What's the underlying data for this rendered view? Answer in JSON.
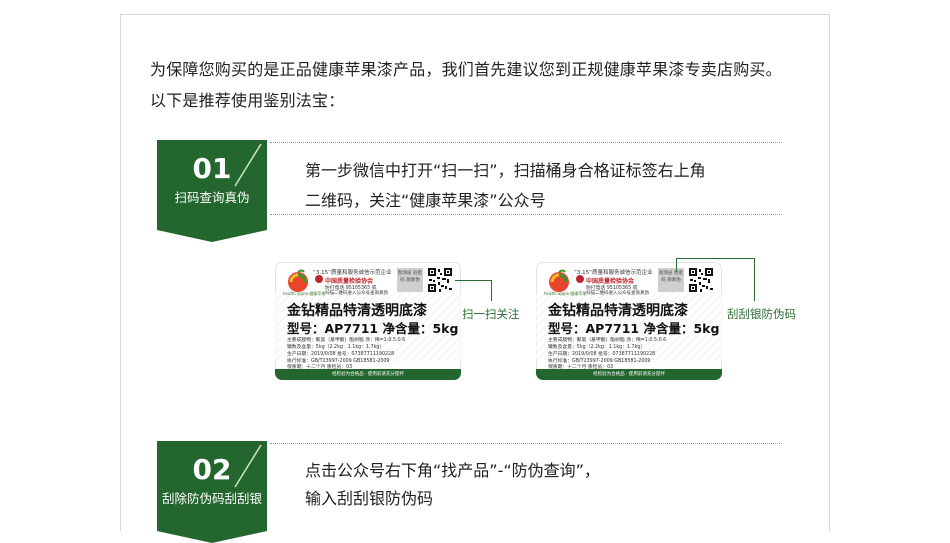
{
  "intro": {
    "line1": "为保障您购买的是正品健康苹果漆产品，我们首先建议您到正规健康苹果漆专卖店购买。",
    "line2": "以下是推荐使用鉴别法宝："
  },
  "steps": [
    {
      "number": "01",
      "title": "扫码查询真伪",
      "text1": "第一步微信中打开“扫一扫”，扫描桶身合格证标签右上角",
      "text2": "二维码，关注“健康苹果漆”公众号"
    },
    {
      "number": "02",
      "title": "刮除防伪码刮刮银",
      "text1": "点击公众号右下角“找产品”-“防伪查询”，",
      "text2": "输入刮刮银防伪码"
    }
  ],
  "label": {
    "logo_text": "health apple 健康苹果",
    "header1": "“3.15”质量和服务诚信示范企业",
    "header2": "中国质量检验协会",
    "header3": "防打电话 95105365 或",
    "header4": "扫描二维码进入公众号查询真伪",
    "scratch_text": "刮涂层 验密码 辨真伪",
    "product_name": "金钻精品特清透明底漆",
    "model_line": "型号：AP7711 净含量：5kg",
    "spec1": "主要成膜物：聚氨（基甲酸）酯树脂    涂：稀=1:0.5:0.6",
    "spec2": "罐数及含量：5kg（2.2kg：1.1kg：1.7kg）",
    "spec3": "生产日期：2019/0/08   批号：07387711190228",
    "spec4": "执行标准：GB/T23997-2009   GB18581-2009",
    "spec5": "保质期：十二个月   质检员：03",
    "footer": "经检验为合格品 · 使用前请充分搅拌"
  },
  "callouts": {
    "scan": "扫一扫关注",
    "scratch": "刮刮银防伪码"
  },
  "colors": {
    "brand_green": "#23662e",
    "text": "#222222",
    "accent_red": "#c0262c"
  }
}
